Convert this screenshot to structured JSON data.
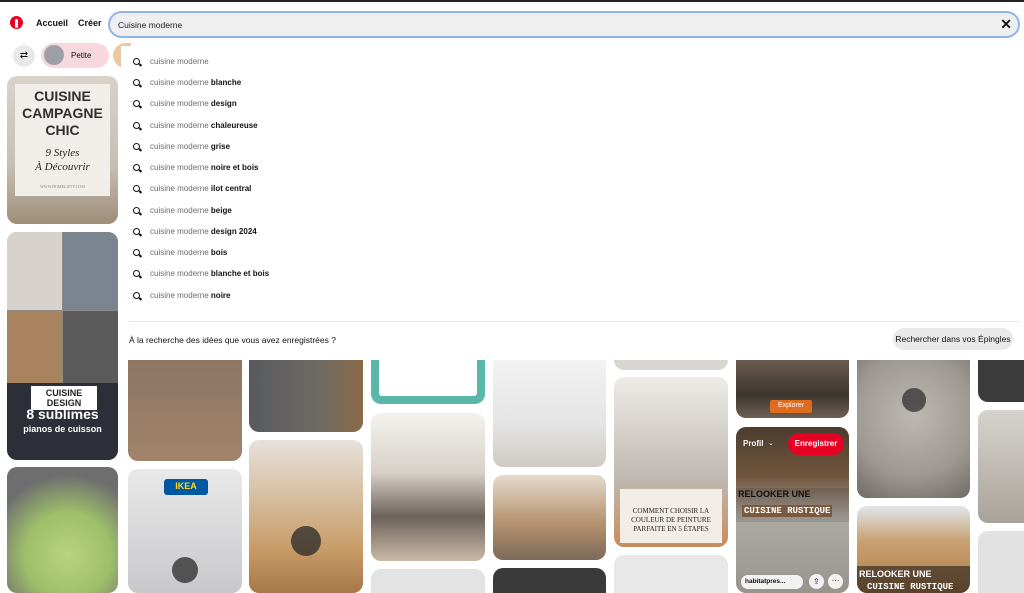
{
  "header": {
    "home_label": "Accueil",
    "create_label": "Créer"
  },
  "search": {
    "value": "Cuisine moderne"
  },
  "filters": {
    "chip_label": "Petite"
  },
  "suggestions": [
    {
      "base": "cuisine moderne",
      "bold": ""
    },
    {
      "base": "cuisine moderne ",
      "bold": "blanche"
    },
    {
      "base": "cuisine moderne ",
      "bold": "design"
    },
    {
      "base": "cuisine moderne ",
      "bold": "chaleureuse"
    },
    {
      "base": "cuisine moderne ",
      "bold": "grise"
    },
    {
      "base": "cuisine moderne ",
      "bold": "noire et bois"
    },
    {
      "base": "cuisine moderne ",
      "bold": "ilot central"
    },
    {
      "base": "cuisine moderne ",
      "bold": "beige"
    },
    {
      "base": "cuisine moderne ",
      "bold": "design 2024"
    },
    {
      "base": "cuisine moderne ",
      "bold": "bois"
    },
    {
      "base": "cuisine moderne ",
      "bold": "blanche et bois"
    },
    {
      "base": "cuisine moderne ",
      "bold": "noire"
    }
  ],
  "saved": {
    "question": "À la recherche des idées que vous avez enregistrées ?",
    "button": "Rechercher dans vos Épingles"
  },
  "pins": {
    "p1": {
      "line1": "CUISINE",
      "line2": "CAMPAGNE",
      "line3": "CHIC",
      "sub1": "9 Styles",
      "sub2": "À Découvrir",
      "site": "WWW.HOMELISTY.COM"
    },
    "p2": {
      "title": "CUISINE DESIGN",
      "big": "8 sublimes",
      "small": "pianos de cuisson"
    },
    "ikea": "IKEA",
    "explore": "Explorer",
    "profile": "Profil",
    "save": "Enregistrer",
    "paint1": "COMMENT CHOISIR LA",
    "paint2": "COULEUR DE PEINTURE",
    "paint3": "PARFAITE EN 5 ÉTAPES",
    "relooker1": "RELOOKER UNE",
    "relooker2": "CUISINE RUSTIQUE",
    "relooker3": "RELOOKER UNE",
    "relooker4": "CUISINE RUSTIQUE",
    "domain": "habitatpres..."
  },
  "colors": {
    "brand": "#e60023",
    "search_border": "#8fb4e8"
  }
}
